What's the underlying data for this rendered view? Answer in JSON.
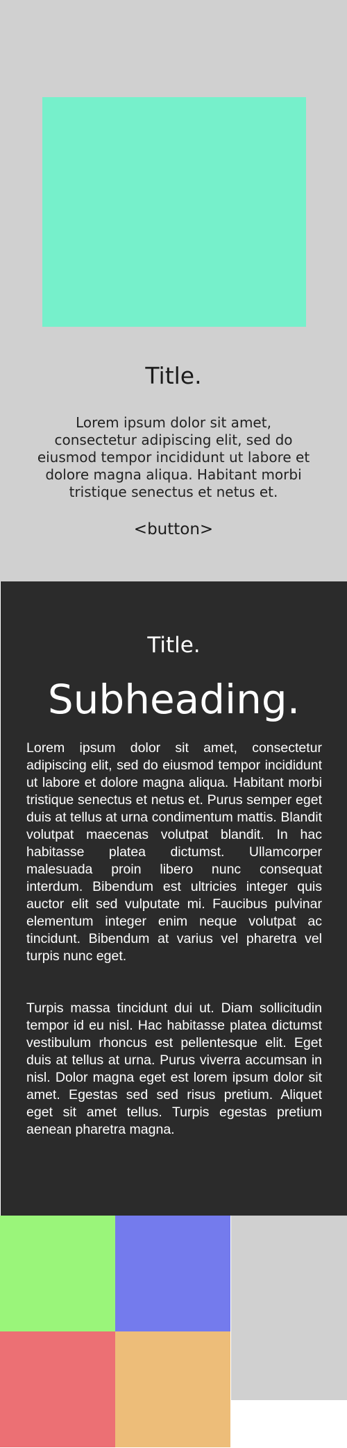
{
  "hero": {
    "title": "Title.",
    "body": "Lorem ipsum dolor sit amet, consectetur adipiscing elit, sed do eiusmod tempor incididunt ut labore et dolore magna aliqua. Habitant morbi tristique senectus et netus et.",
    "button_label": "<button>",
    "colors": {
      "background": "#d0d0d0",
      "image": "#76f0cb"
    }
  },
  "dark_section": {
    "title": "Title.",
    "subheading": "Subheading.",
    "paragraphs": [
      "Lorem ipsum dolor sit amet, consectetur adipiscing elit, sed do eiusmod tempor incididunt ut labore et dolore magna aliqua. Habitant morbi tristique senectus et netus et. Purus semper eget duis at tellus at urna condimentum mattis. Blandit volutpat maecenas volutpat blandit. In hac habitasse platea dictumst. Ullamcorper malesuada proin libero nunc consequat interdum. Bibendum est ultricies integer quis auctor elit sed vulputate mi. Faucibus pulvinar elementum integer enim neque volutpat ac tincidunt. Bibendum at varius vel pharetra vel turpis nunc eget.",
      "Turpis massa tincidunt dui ut. Diam sollicitudin tempor id eu nisl. Hac habitasse platea dictumst vestibulum rhoncus est pellentesque elit. Eget duis at tellus at urna. Purus viverra accumsan in nisl. Dolor magna eget est lorem ipsum dolor sit amet. Egestas sed sed risus pretium. Aliquet eget sit amet tellus. Turpis egestas pretium aenean pharetra magna."
    ],
    "colors": {
      "background": "#2b2b2b",
      "text": "#ffffff"
    }
  },
  "tiles": {
    "colors": {
      "green": "#9af57a",
      "blue": "#747bed",
      "red": "#ec7074",
      "orange": "#edbd79",
      "gray": "#d0d0d0"
    }
  }
}
